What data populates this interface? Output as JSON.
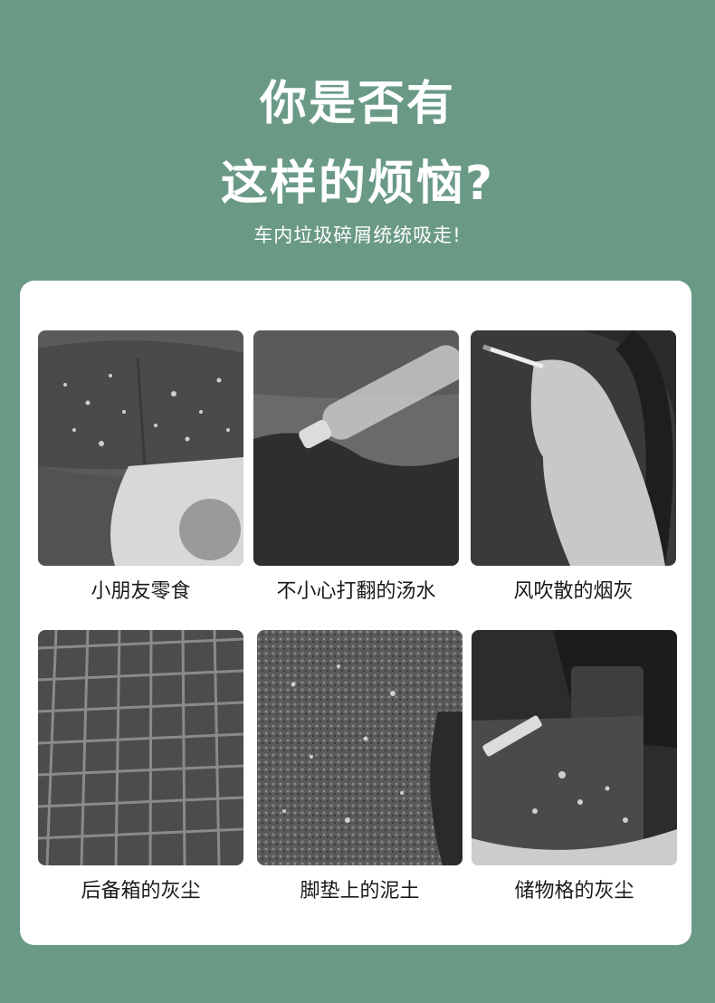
{
  "header": {
    "title_line1": "你是否有",
    "title_line2": "这样的烦恼?",
    "subtitle": "车内垃圾碎屑统统吸走!"
  },
  "items": [
    {
      "caption": "小朋友零食"
    },
    {
      "caption": "不小心打翻的汤水"
    },
    {
      "caption": "风吹散的烟灰"
    },
    {
      "caption": "后备箱的灰尘"
    },
    {
      "caption": "脚垫上的泥土"
    },
    {
      "caption": "储物格的灰尘"
    }
  ],
  "colors": {
    "background": "#6a9a86",
    "card": "#ffffff",
    "title": "#ffffff",
    "caption": "#1a1a1a"
  }
}
